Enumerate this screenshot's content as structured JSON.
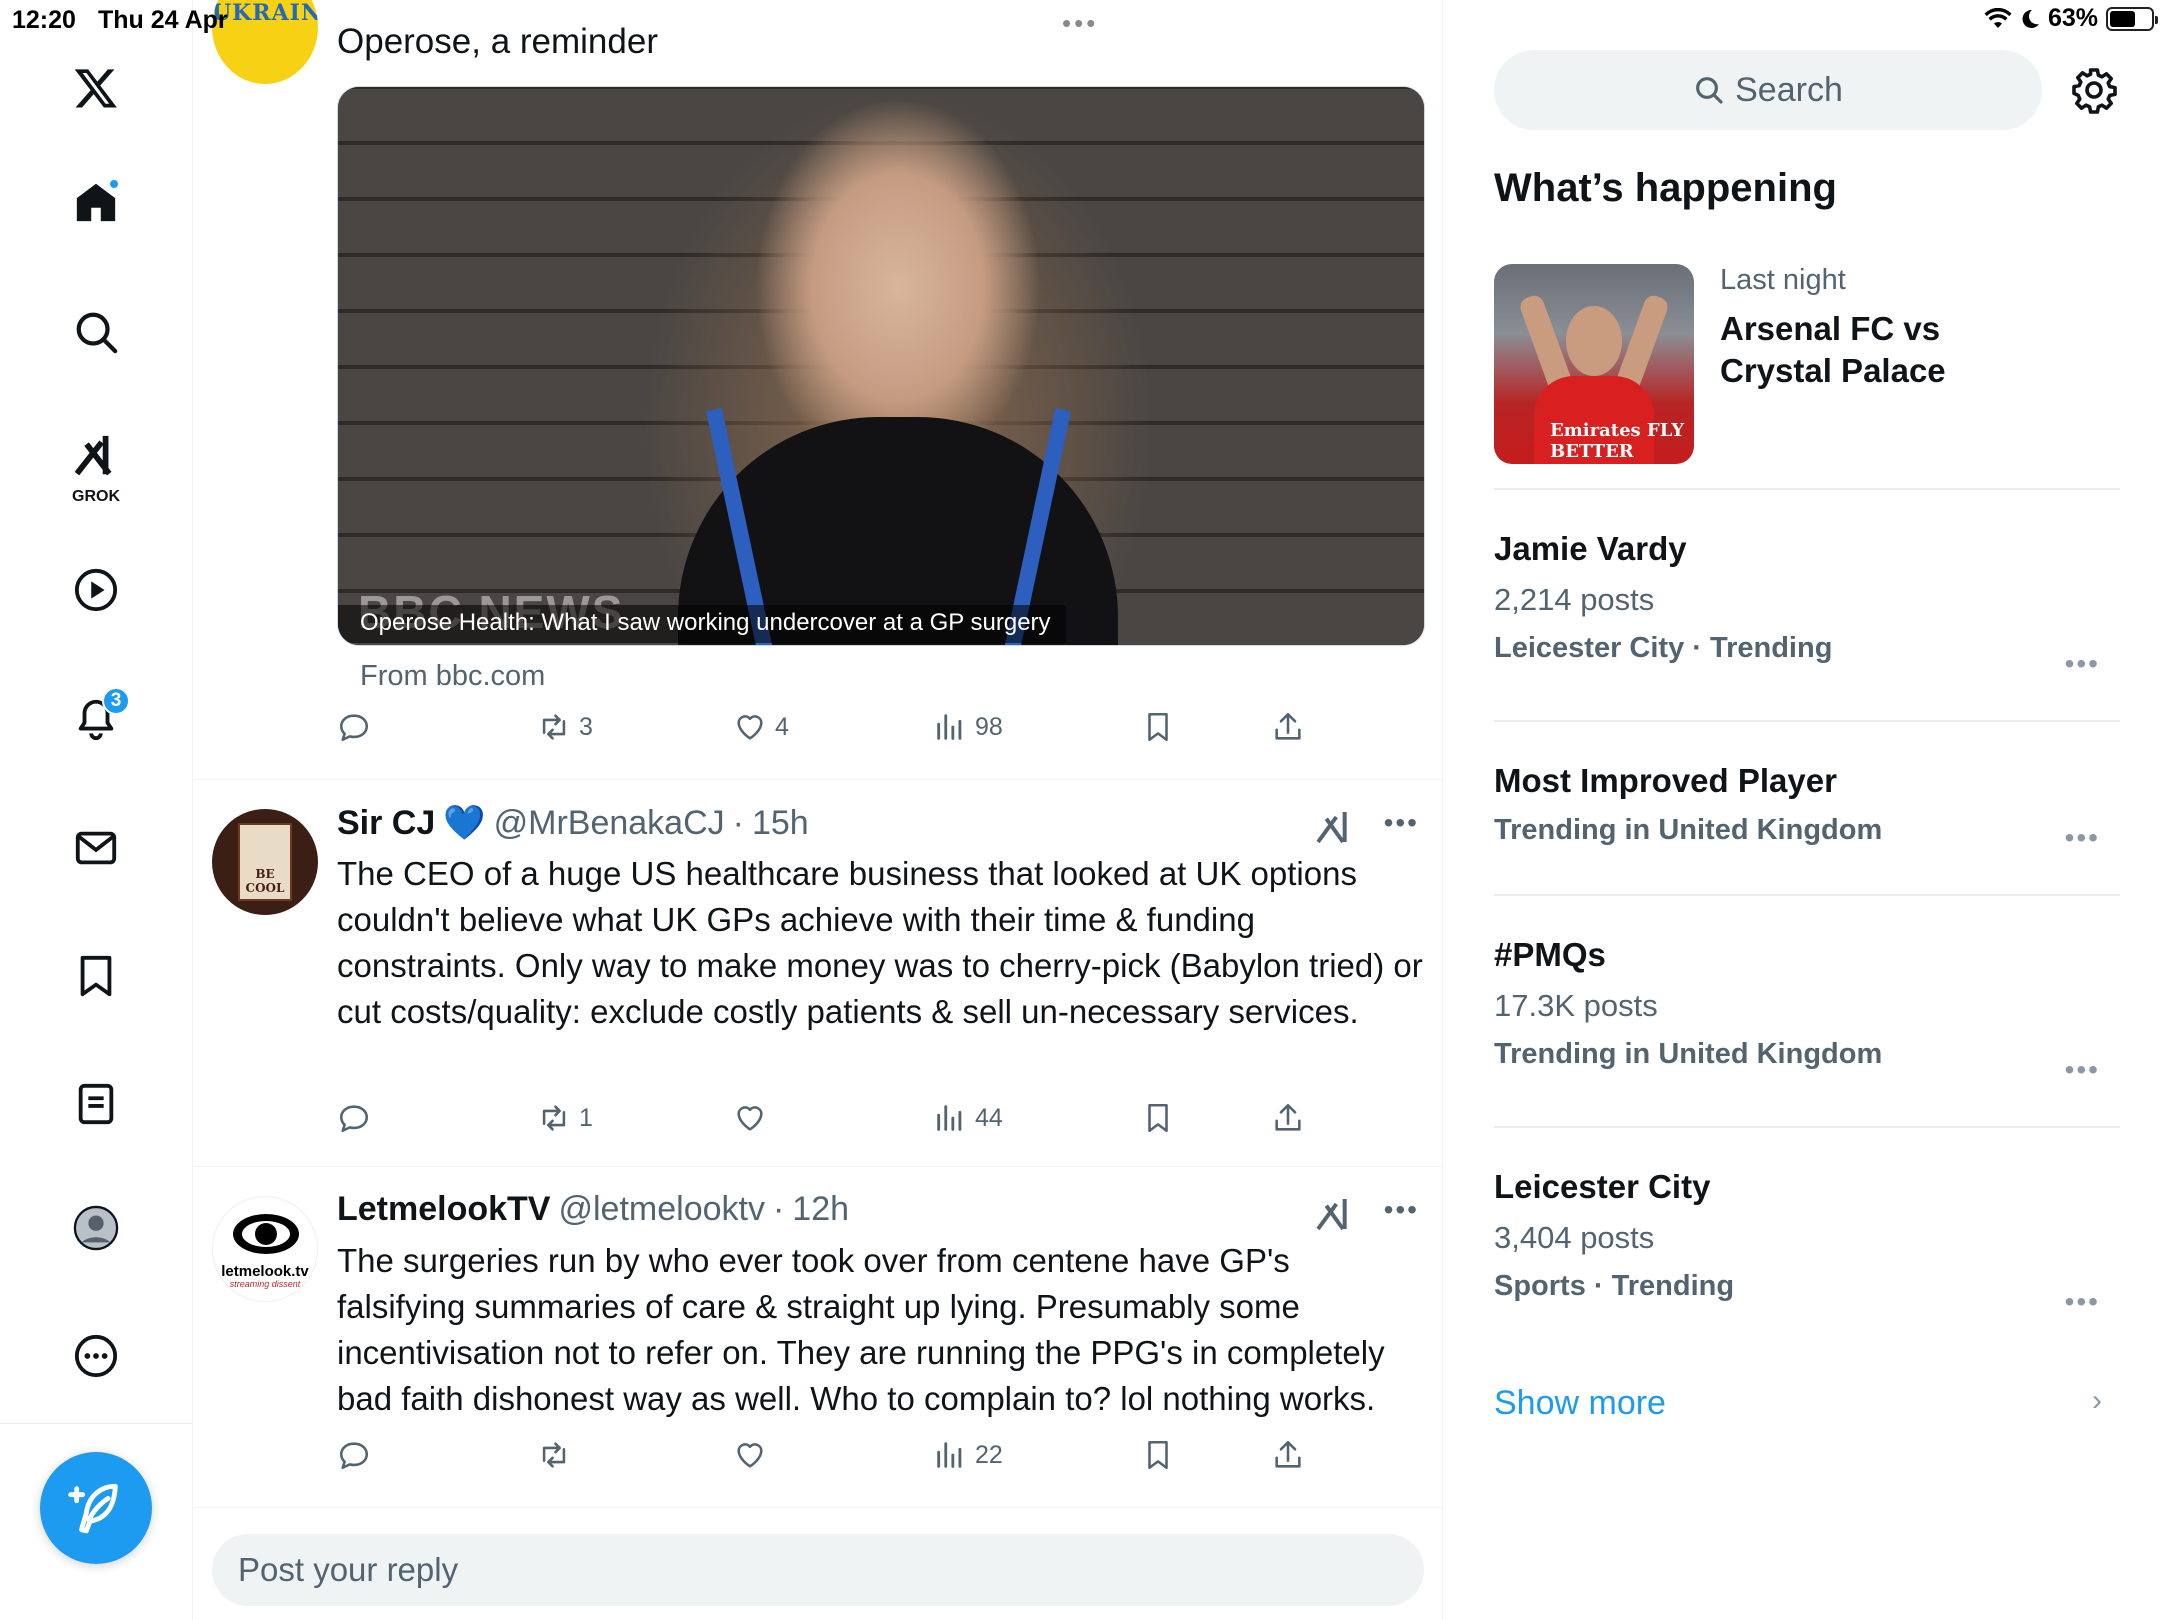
{
  "status_bar": {
    "time": "12:20",
    "date": "Thu 24 Apr",
    "battery": "63%",
    "battery_level": 0.63
  },
  "nav": {
    "grok_label": "GROK",
    "notifications_badge": "3",
    "icons": [
      "x-logo-icon",
      "home-icon",
      "search-icon",
      "grok-icon",
      "video-icon",
      "bell-icon",
      "mail-icon",
      "bookmark-icon",
      "list-icon",
      "profile-icon",
      "more-icon",
      "compose-icon"
    ]
  },
  "top_tweet": {
    "avatar_text": "UKRAINE",
    "text_partial": "Operose, a reminder",
    "card": {
      "watermark": "BBC NEWS",
      "caption": "Operose Health: What I saw working undercover at a GP surgery",
      "source": "From bbc.com"
    },
    "stats": {
      "retweets": "3",
      "likes": "4",
      "views": "98"
    }
  },
  "tweets": [
    {
      "name": "Sir CJ",
      "emoji": "💙",
      "handle": "@MrBenakaCJ",
      "sep": "·",
      "time": "15h",
      "avatar_text": "BE COOL",
      "text": "The CEO of a huge US healthcare business that looked at UK options couldn't believe what UK GPs achieve with their time & funding constraints. Only way to make money was to cherry-pick (Babylon tried) or cut costs/quality: exclude costly patients & sell un-necessary services.",
      "stats": {
        "retweets": "1",
        "likes": "",
        "views": "44"
      }
    },
    {
      "name": "LetmelookTV",
      "handle": "@letmelooktv",
      "sep": "·",
      "time": "12h",
      "avatar_text": "letmelook.tv",
      "avatar_sub": "streaming dissent",
      "text": "The surgeries run by who ever took over from centene have GP's falsifying summaries of care & straight up lying. Presumably some incentivisation not to refer on. They are running the PPG's in completely bad faith dishonest way as well. Who to complain to? lol nothing works.",
      "stats": {
        "retweets": "",
        "likes": "",
        "views": "22"
      }
    }
  ],
  "reply": {
    "placeholder": "Post your reply"
  },
  "sidebar": {
    "search_label": "Search",
    "title": "What’s happening",
    "featured": {
      "meta": "Last night",
      "title": "Arsenal FC vs Crystal Palace",
      "img_text": "Emirates FLY BETTER"
    },
    "trends": [
      {
        "name": "Jamie Vardy",
        "count": "2,214 posts",
        "category": "Leicester City · Trending"
      },
      {
        "name": "Most Improved Player",
        "count": "",
        "category": "Trending in United Kingdom"
      },
      {
        "name": "#PMQs",
        "count": "17.3K posts",
        "category": "Trending in United Kingdom"
      },
      {
        "name": "Leicester City",
        "count": "3,404 posts",
        "category": "Sports · Trending"
      }
    ],
    "show_more": "Show more"
  },
  "colors": {
    "accent": "#1d9bf0",
    "text": "#0f1419",
    "muted": "#536471",
    "border": "#eff3f4"
  }
}
